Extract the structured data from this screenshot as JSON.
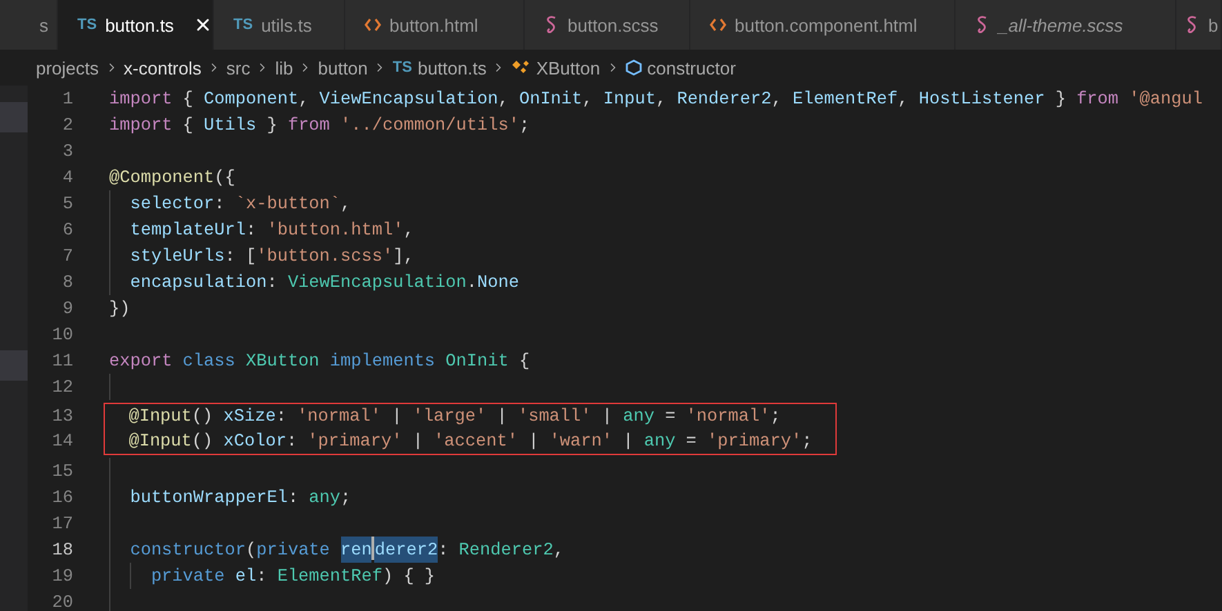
{
  "tabs": [
    {
      "label": "s",
      "kind": "partial",
      "selected": false,
      "italic": false
    },
    {
      "label": "button.ts",
      "kind": "ts",
      "badge": "TS",
      "selected": true,
      "italic": false
    },
    {
      "label": "utils.ts",
      "kind": "ts",
      "badge": "TS",
      "selected": false,
      "italic": false
    },
    {
      "label": "button.html",
      "kind": "html",
      "selected": false,
      "italic": false
    },
    {
      "label": "button.scss",
      "kind": "scss",
      "selected": false,
      "italic": false
    },
    {
      "label": "button.component.html",
      "kind": "html",
      "selected": false,
      "italic": false
    },
    {
      "label": "_all-theme.scss",
      "kind": "scss",
      "selected": false,
      "italic": true
    },
    {
      "label": "b",
      "kind": "scss",
      "selected": false,
      "italic": false
    }
  ],
  "breadcrumbs": [
    {
      "label": "projects",
      "kind": "folder"
    },
    {
      "label": "x-controls",
      "kind": "folder"
    },
    {
      "label": "src",
      "kind": "folder"
    },
    {
      "label": "lib",
      "kind": "folder"
    },
    {
      "label": "button",
      "kind": "folder"
    },
    {
      "label": "button.ts",
      "kind": "ts",
      "badge": "TS"
    },
    {
      "label": "XButton",
      "kind": "class"
    },
    {
      "label": "constructor",
      "kind": "method"
    }
  ],
  "lines": [
    {
      "n": "1",
      "boxed": false,
      "current": false,
      "tokens": [
        {
          "t": "import",
          "kind": "ctrl"
        },
        {
          "t": " { ",
          "kind": "p"
        },
        {
          "t": "Component",
          "kind": "var"
        },
        {
          "t": ", ",
          "kind": "p"
        },
        {
          "t": "ViewEncapsulation",
          "kind": "var"
        },
        {
          "t": ", ",
          "kind": "p"
        },
        {
          "t": "OnInit",
          "kind": "var"
        },
        {
          "t": ", ",
          "kind": "p"
        },
        {
          "t": "Input",
          "kind": "var"
        },
        {
          "t": ", ",
          "kind": "p"
        },
        {
          "t": "Renderer2",
          "kind": "var"
        },
        {
          "t": ", ",
          "kind": "p"
        },
        {
          "t": "ElementRef",
          "kind": "var"
        },
        {
          "t": ", ",
          "kind": "p"
        },
        {
          "t": "HostListener",
          "kind": "var"
        },
        {
          "t": " } ",
          "kind": "p"
        },
        {
          "t": "from ",
          "kind": "ctrl"
        },
        {
          "t": "'@angul",
          "kind": "str"
        }
      ]
    },
    {
      "n": "2",
      "boxed": false,
      "current": false,
      "tokens": [
        {
          "t": "import",
          "kind": "ctrl"
        },
        {
          "t": " { ",
          "kind": "p"
        },
        {
          "t": "Utils",
          "kind": "var"
        },
        {
          "t": " } ",
          "kind": "p"
        },
        {
          "t": "from ",
          "kind": "ctrl"
        },
        {
          "t": "'../common/utils'",
          "kind": "str"
        },
        {
          "t": ";",
          "kind": "p"
        }
      ]
    },
    {
      "n": "3",
      "boxed": false,
      "current": false
    },
    {
      "n": "4",
      "boxed": false,
      "current": false,
      "tokens": [
        {
          "t": "@Component",
          "kind": "fn"
        },
        {
          "t": "({",
          "kind": "p"
        }
      ]
    },
    {
      "n": "5",
      "kind": "inner",
      "boxed": false,
      "current": false,
      "tokens": [
        {
          "t": "selector",
          "kind": "var"
        },
        {
          "t": ": ",
          "kind": "p"
        },
        {
          "t": "`x-button`",
          "kind": "str"
        },
        {
          "t": ",",
          "kind": "p"
        }
      ]
    },
    {
      "n": "6",
      "kind": "inner",
      "boxed": false,
      "current": false,
      "tokens": [
        {
          "t": "templateUrl",
          "kind": "var"
        },
        {
          "t": ": ",
          "kind": "p"
        },
        {
          "t": "'button.html'",
          "kind": "str"
        },
        {
          "t": ",",
          "kind": "p"
        }
      ]
    },
    {
      "n": "7",
      "kind": "inner",
      "boxed": false,
      "current": false,
      "tokens": [
        {
          "t": "styleUrls",
          "kind": "var"
        },
        {
          "t": ": [",
          "kind": "p"
        },
        {
          "t": "'button.scss'",
          "kind": "str"
        },
        {
          "t": "],",
          "kind": "p"
        }
      ]
    },
    {
      "n": "8",
      "kind": "inner",
      "boxed": false,
      "current": false,
      "tokens": [
        {
          "t": "encapsulation",
          "kind": "var"
        },
        {
          "t": ": ",
          "kind": "p"
        },
        {
          "t": "ViewEncapsulation",
          "kind": "type"
        },
        {
          "t": ".",
          "kind": "p"
        },
        {
          "t": "None",
          "kind": "var"
        }
      ]
    },
    {
      "n": "9",
      "boxed": false,
      "current": false,
      "tokens": [
        {
          "t": "})",
          "kind": "p"
        }
      ]
    },
    {
      "n": "10",
      "boxed": false,
      "current": false
    },
    {
      "n": "11",
      "boxed": false,
      "current": false,
      "tokens": [
        {
          "t": "export ",
          "kind": "ctrl"
        },
        {
          "t": "class ",
          "kind": "kw"
        },
        {
          "t": "XButton ",
          "kind": "type"
        },
        {
          "t": "implements ",
          "kind": "kw"
        },
        {
          "t": "OnInit",
          "kind": "type"
        },
        {
          "t": " {",
          "kind": "p"
        }
      ]
    },
    {
      "n": "12",
      "kind": "inner",
      "boxed": false,
      "current": false
    },
    {
      "n": "13",
      "kind": "inner",
      "boxed": true,
      "current": false,
      "tokens": [
        {
          "t": "@Input",
          "kind": "fn"
        },
        {
          "t": "() ",
          "kind": "p"
        },
        {
          "t": "xSize",
          "kind": "var"
        },
        {
          "t": ": ",
          "kind": "p"
        },
        {
          "t": "'normal'",
          "kind": "str"
        },
        {
          "t": " | ",
          "kind": "p"
        },
        {
          "t": "'large'",
          "kind": "str"
        },
        {
          "t": " | ",
          "kind": "p"
        },
        {
          "t": "'small'",
          "kind": "str"
        },
        {
          "t": " | ",
          "kind": "p"
        },
        {
          "t": "any",
          "kind": "type"
        },
        {
          "t": " = ",
          "kind": "p"
        },
        {
          "t": "'normal'",
          "kind": "str"
        },
        {
          "t": ";",
          "kind": "p"
        }
      ]
    },
    {
      "n": "14",
      "kind": "inner",
      "boxed": true,
      "current": false,
      "tokens": [
        {
          "t": "@Input",
          "kind": "fn"
        },
        {
          "t": "() ",
          "kind": "p"
        },
        {
          "t": "xColor",
          "kind": "var"
        },
        {
          "t": ": ",
          "kind": "p"
        },
        {
          "t": "'primary'",
          "kind": "str"
        },
        {
          "t": " | ",
          "kind": "p"
        },
        {
          "t": "'accent'",
          "kind": "str"
        },
        {
          "t": " | ",
          "kind": "p"
        },
        {
          "t": "'warn'",
          "kind": "str"
        },
        {
          "t": " | ",
          "kind": "p"
        },
        {
          "t": "any",
          "kind": "type"
        },
        {
          "t": " = ",
          "kind": "p"
        },
        {
          "t": "'primary'",
          "kind": "str"
        },
        {
          "t": ";",
          "kind": "p"
        }
      ]
    },
    {
      "n": "15",
      "kind": "inner",
      "boxed": false,
      "current": false
    },
    {
      "n": "16",
      "kind": "inner",
      "boxed": false,
      "current": false,
      "tokens": [
        {
          "t": "buttonWrapperEl",
          "kind": "var"
        },
        {
          "t": ": ",
          "kind": "p"
        },
        {
          "t": "any",
          "kind": "type"
        },
        {
          "t": ";",
          "kind": "p"
        }
      ]
    },
    {
      "n": "17",
      "kind": "inner",
      "boxed": false,
      "current": false
    },
    {
      "n": "18",
      "kind": "inner",
      "boxed": false,
      "current": true,
      "tokens": [
        {
          "t": "constructor",
          "kind": "kw"
        },
        {
          "t": "(",
          "kind": "p"
        },
        {
          "t": "private ",
          "kind": "kw"
        },
        {
          "t": "ren",
          "kind": "var",
          "selected": true,
          "cursor": true
        },
        {
          "t": "derer2",
          "kind": "var",
          "selected": true
        },
        {
          "t": ": ",
          "kind": "p"
        },
        {
          "t": "Renderer2",
          "kind": "type"
        },
        {
          "t": ",",
          "kind": "p"
        }
      ]
    },
    {
      "n": "19",
      "kind": "deeper",
      "boxed": false,
      "current": false,
      "tokens": [
        {
          "t": "private ",
          "kind": "kw"
        },
        {
          "t": "el",
          "kind": "var"
        },
        {
          "t": ": ",
          "kind": "p"
        },
        {
          "t": "ElementRef",
          "kind": "type"
        },
        {
          "t": ") { }",
          "kind": "p"
        }
      ]
    },
    {
      "n": "20",
      "kind": "inner",
      "boxed": false,
      "current": false
    }
  ]
}
